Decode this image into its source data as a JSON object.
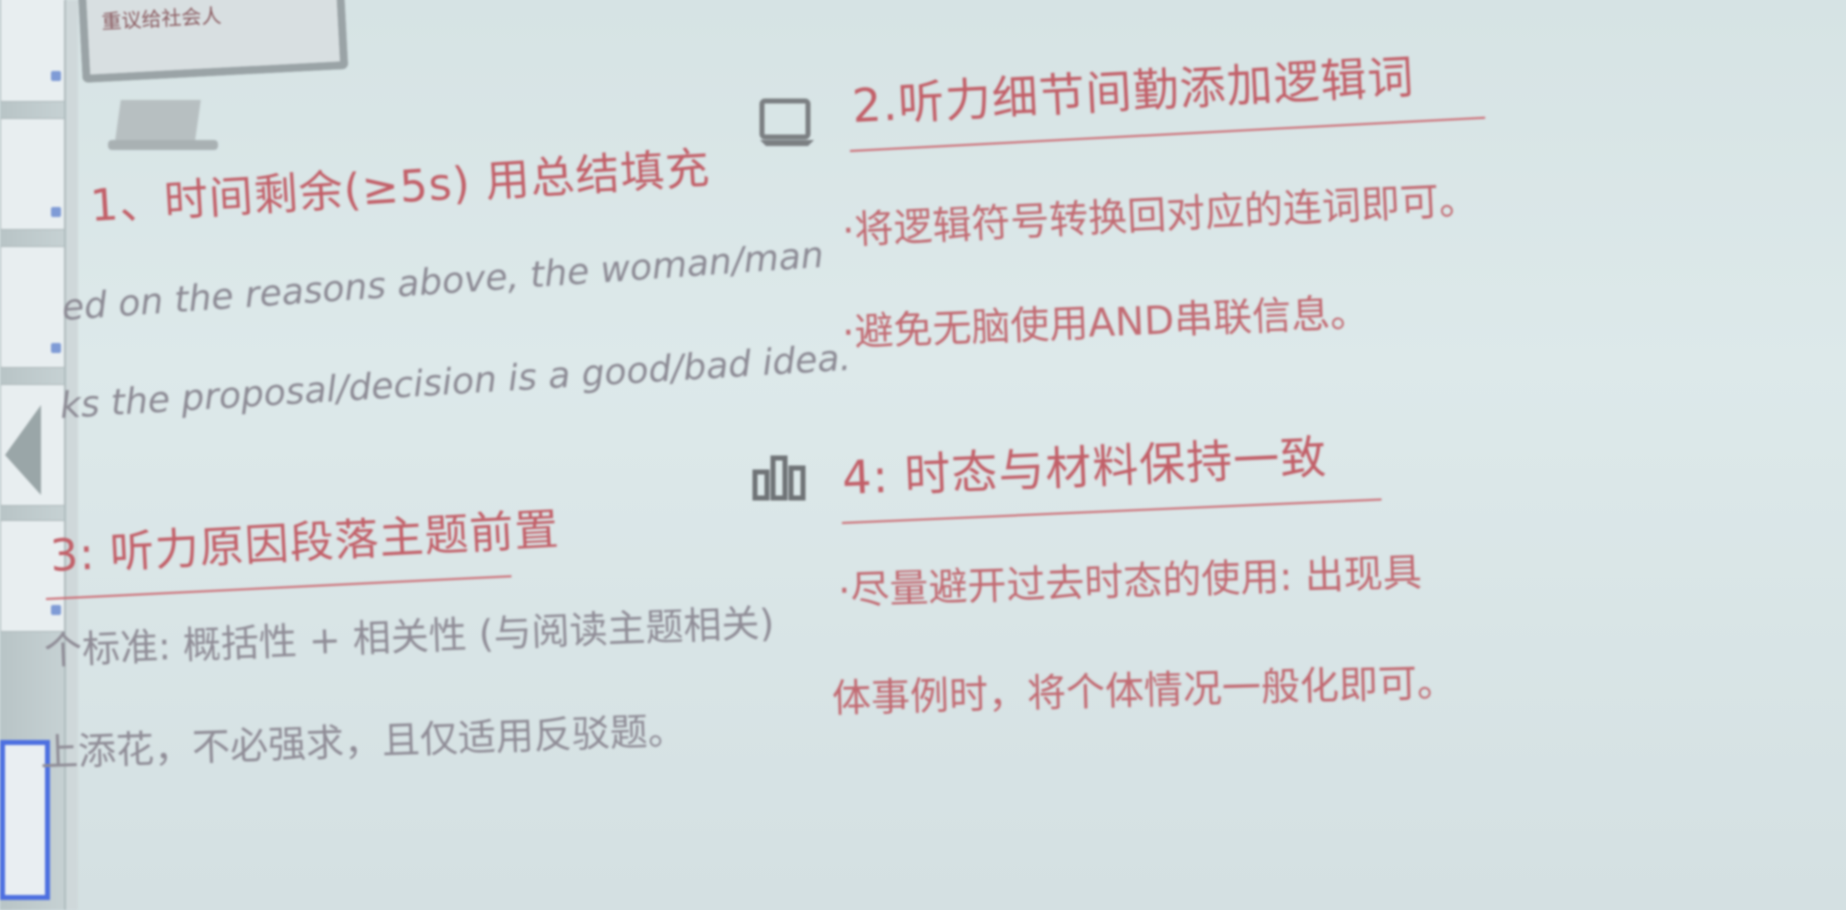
{
  "monitor_caption": "重议给社会人",
  "sections": {
    "s1": {
      "heading": "1、时间剩余(≥5s) 用总结填充",
      "lines": [
        "ed on the reasons above, the woman/man",
        "ks the proposal/decision is a good/bad idea."
      ]
    },
    "s2": {
      "heading": "2.听力细节间勤添加逻辑词",
      "lines": [
        "·将逻辑符号转换回对应的连词即可。",
        "·避免无脑使用AND串联信息。"
      ]
    },
    "s3": {
      "heading": "3: 听力原因段落主题前置",
      "lines": [
        "个标准: 概括性 + 相关性 (与阅读主题相关)",
        "上添花，不必强求，且仅适用反驳题。"
      ]
    },
    "s4": {
      "heading": "4: 时态与材料保持一致",
      "lines": [
        "·尽量避开过去时态的使用: 出现具",
        "体事例时，将个体情况一般化即可。"
      ]
    }
  },
  "icons": {
    "s2_icon": "laptop-icon",
    "s4_icon": "bar-chart-icon"
  },
  "colors": {
    "heading": "#c25f68",
    "red_text": "#c26a72",
    "grey_text": "#8c8a94",
    "background": "#d9e5e6",
    "thumb_highlight": "#4d6fe0"
  }
}
